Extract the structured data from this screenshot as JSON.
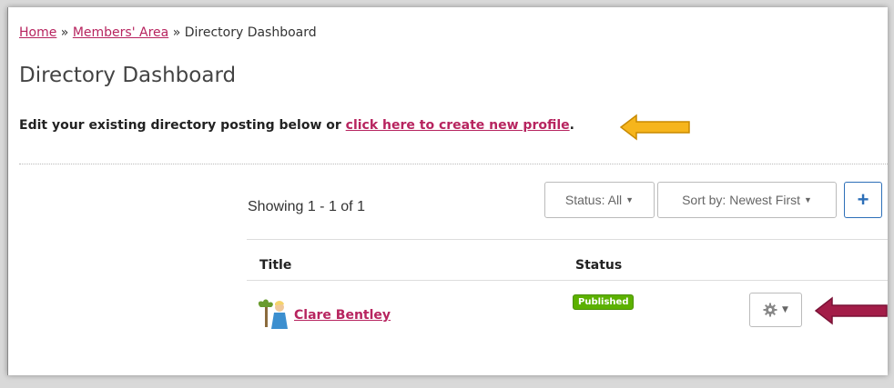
{
  "breadcrumb": {
    "home": "Home",
    "sep1": "»",
    "members": "Members' Area",
    "sep2": "»",
    "current": "Directory Dashboard"
  },
  "page_title": "Directory Dashboard",
  "intro": {
    "text": "Edit your existing directory posting below or ",
    "link": "click here to create new profile",
    "end": "."
  },
  "listing": {
    "showing": "Showing 1 - 1 of 1",
    "status_filter": "Status: All",
    "sort": "Sort by: Newest First",
    "add_label": "+"
  },
  "table": {
    "headers": {
      "title": "Title",
      "status": "Status"
    },
    "rows": [
      {
        "title": "Clare Bentley",
        "status": "Published"
      }
    ]
  },
  "colors": {
    "link": "#b7245f",
    "badge": "#5cb100",
    "arrow_yellow": "#f6b51c",
    "arrow_red": "#a31d48",
    "add_button": "#2d6fb8"
  },
  "icons": [
    "avatar-icon",
    "gear-icon",
    "caret-down-icon",
    "plus-icon",
    "arrow-left-icon"
  ]
}
